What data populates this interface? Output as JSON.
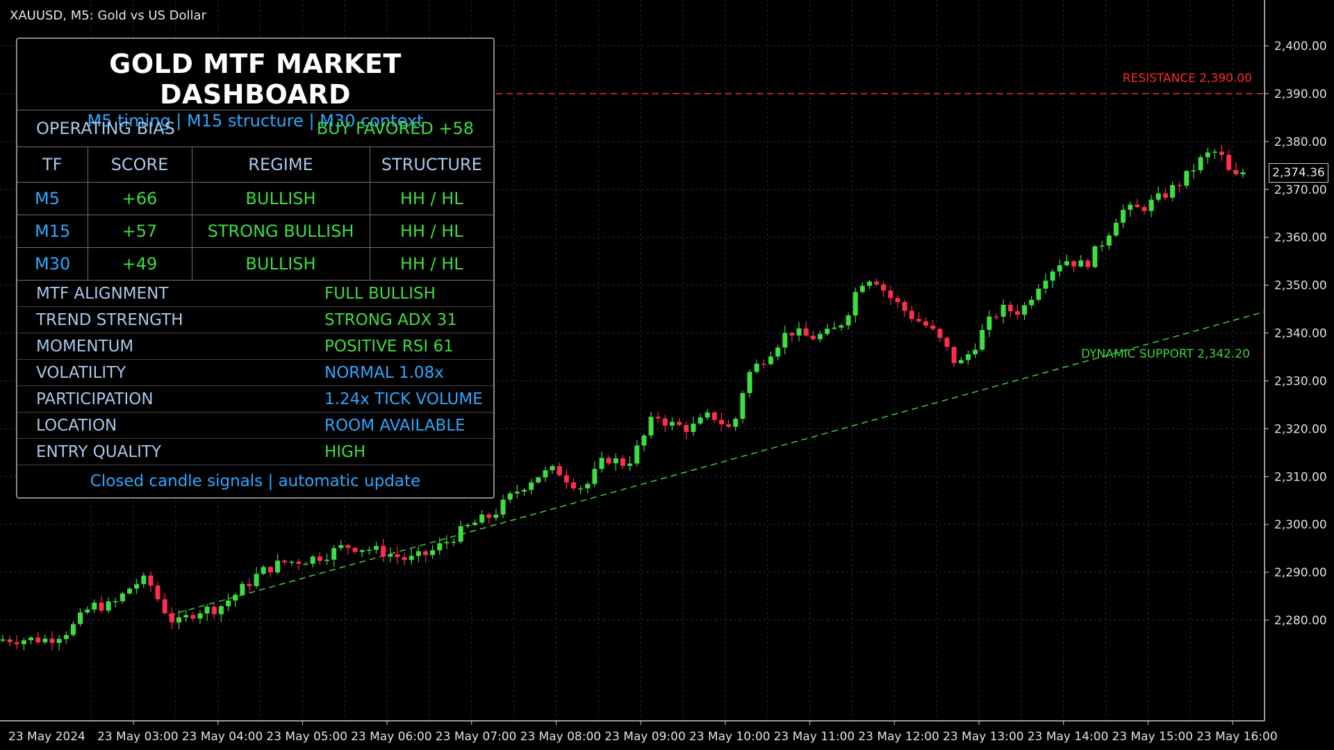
{
  "window": {
    "symbol_title": "XAUUSD, M5:  Gold vs US Dollar"
  },
  "colors": {
    "bull": "#3fdd3f",
    "bear": "#ff2e4d",
    "resistance": "#ff2a2a",
    "support": "#3fd23f",
    "accent_blue": "#2ea8ff",
    "label": "#a9c8ea"
  },
  "dashboard": {
    "title": "GOLD MTF MARKET DASHBOARD",
    "subtitle": "M5 timing | M15 structure | M30 context",
    "bias_label": "OPERATING BIAS",
    "bias_value": "BUY FAVORED +58",
    "table_headers": [
      "TF",
      "SCORE",
      "REGIME",
      "STRUCTURE"
    ],
    "table_rows": [
      {
        "tf": "M5",
        "score": "+66",
        "regime": "BULLISH",
        "structure": "HH / HL"
      },
      {
        "tf": "M15",
        "score": "+57",
        "regime": "STRONG BULLISH",
        "structure": "HH / HL"
      },
      {
        "tf": "M30",
        "score": "+49",
        "regime": "BULLISH",
        "structure": "HH / HL"
      }
    ],
    "metrics": [
      {
        "label": "MTF ALIGNMENT",
        "value": "FULL BULLISH",
        "color": "#3fdd3f"
      },
      {
        "label": "TREND STRENGTH",
        "value": "STRONG ADX 31",
        "color": "#3fdd3f"
      },
      {
        "label": "MOMENTUM",
        "value": "POSITIVE RSI 61",
        "color": "#3fdd3f"
      },
      {
        "label": "VOLATILITY",
        "value": "NORMAL 1.08x",
        "color": "#2ea8ff"
      },
      {
        "label": "PARTICIPATION",
        "value": "1.24x TICK VOLUME",
        "color": "#2ea8ff"
      },
      {
        "label": "LOCATION",
        "value": "ROOM AVAILABLE",
        "color": "#2ea8ff"
      },
      {
        "label": "ENTRY QUALITY",
        "value": "HIGH",
        "color": "#3fdd3f"
      }
    ],
    "footer": "Closed candle signals | automatic update"
  },
  "lines": {
    "resistance_label": "RESISTANCE  2,390.00",
    "resistance_price": 2390.0,
    "support_label": "DYNAMIC SUPPORT  2,342.20",
    "support_start": {
      "time": "03:25",
      "price": 2281.0
    },
    "support_end": {
      "time": "16:05",
      "price": 2343.0
    }
  },
  "current_price_label": "2,374.36",
  "chart_data": {
    "type": "candlestick",
    "title": "",
    "timeframe": "M5",
    "ylim": [
      2272,
      2405
    ],
    "y_ticks": [
      2400,
      2390,
      2380,
      2370,
      2360,
      2350,
      2340,
      2330,
      2320,
      2310,
      2300,
      2290,
      2280
    ],
    "y_tick_labels": [
      "2,400.00",
      "2,390.00",
      "2,380.00",
      "2,370.00",
      "2,360.00",
      "2,350.00",
      "2,340.00",
      "2,330.00",
      "2,320.00",
      "2,310.00",
      "2,300.00",
      "2,290.00",
      "2,280.00"
    ],
    "x_tick_labels": [
      "23 May 2024",
      "23 May 03:00",
      "23 May 04:00",
      "23 May 05:00",
      "23 May 06:00",
      "23 May 07:00",
      "23 May 08:00",
      "23 May 09:00",
      "23 May 10:00",
      "23 May 11:00",
      "23 May 12:00",
      "23 May 13:00",
      "23 May 14:00",
      "23 May 15:00",
      "23 May 16:00"
    ],
    "grid": true,
    "close_path": [
      [
        "02:00",
        2276.0
      ],
      [
        "02:15",
        2278.0
      ],
      [
        "02:30",
        2283.0
      ],
      [
        "02:45",
        2283.0
      ],
      [
        "03:00",
        2287.5
      ],
      [
        "03:10",
        2288.5
      ],
      [
        "03:20",
        2283.0
      ],
      [
        "03:30",
        2279.0
      ],
      [
        "03:45",
        2282.0
      ],
      [
        "04:00",
        2282.5
      ],
      [
        "04:15",
        2286.0
      ],
      [
        "04:30",
        2290.0
      ],
      [
        "04:45",
        2292.0
      ],
      [
        "05:00",
        2292.5
      ],
      [
        "05:15",
        2293.5
      ],
      [
        "05:30",
        2295.5
      ],
      [
        "05:45",
        2295.0
      ],
      [
        "06:00",
        2294.0
      ],
      [
        "06:15",
        2292.5
      ],
      [
        "06:30",
        2294.0
      ],
      [
        "06:45",
        2297.0
      ],
      [
        "07:00",
        2300.0
      ],
      [
        "07:15",
        2302.0
      ],
      [
        "07:30",
        2306.5
      ],
      [
        "07:45",
        2310.0
      ],
      [
        "08:00",
        2311.5
      ],
      [
        "08:10",
        2309.0
      ],
      [
        "08:20",
        2307.5
      ],
      [
        "08:35",
        2314.0
      ],
      [
        "08:50",
        2312.5
      ],
      [
        "09:00",
        2317.0
      ],
      [
        "09:10",
        2323.0
      ],
      [
        "09:20",
        2321.0
      ],
      [
        "09:35",
        2320.0
      ],
      [
        "09:50",
        2323.0
      ],
      [
        "10:05",
        2319.5
      ],
      [
        "10:15",
        2331.0
      ],
      [
        "10:30",
        2335.5
      ],
      [
        "10:45",
        2340.5
      ],
      [
        "11:00",
        2339.0
      ],
      [
        "11:15",
        2340.0
      ],
      [
        "11:25",
        2343.0
      ],
      [
        "11:35",
        2350.5
      ],
      [
        "11:45",
        2352.0
      ],
      [
        "11:55",
        2348.0
      ],
      [
        "12:10",
        2344.0
      ],
      [
        "12:25",
        2341.0
      ],
      [
        "12:35",
        2337.5
      ],
      [
        "12:45",
        2333.0
      ],
      [
        "12:55",
        2336.5
      ],
      [
        "13:05",
        2341.5
      ],
      [
        "13:15",
        2345.0
      ],
      [
        "13:30",
        2344.5
      ],
      [
        "13:45",
        2351.5
      ],
      [
        "14:00",
        2355.5
      ],
      [
        "14:15",
        2354.0
      ],
      [
        "14:30",
        2360.0
      ],
      [
        "14:40",
        2365.5
      ],
      [
        "14:55",
        2366.0
      ],
      [
        "15:10",
        2368.5
      ],
      [
        "15:25",
        2372.0
      ],
      [
        "15:40",
        2377.0
      ],
      [
        "15:50",
        2378.0
      ],
      [
        "16:00",
        2372.0
      ],
      [
        "16:05",
        2373.0
      ],
      [
        "16:10",
        2374.36
      ]
    ]
  }
}
